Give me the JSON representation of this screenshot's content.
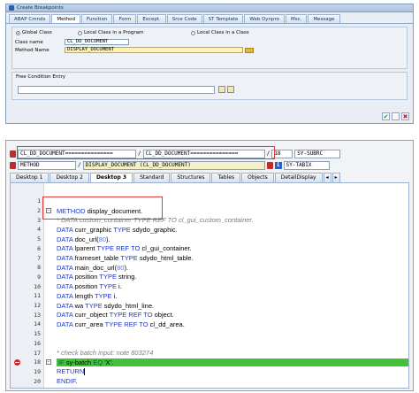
{
  "dialog": {
    "title": "Create Breakpoints",
    "tabs": [
      "ABAP Cmnds",
      "Method",
      "Function",
      "Form",
      "Except.",
      "Srce Code",
      "ST Template",
      "Web Dynpro",
      "Msc.",
      "Message"
    ],
    "active_tab": 1,
    "radios": [
      "Global Class",
      "Local Class in a Program",
      "Local Class in a Class"
    ],
    "selected_radio": 0,
    "class_label": "Class name",
    "class_value": "CL_DD_DOCUMENT",
    "method_label": "Method Name",
    "method_value": "DISPLAY_DOCUMENT",
    "free_entry_label": "Free Condition Entry",
    "ok_glyph": "✔",
    "cancel_glyph": "✖"
  },
  "debugger": {
    "var1_left": "CL_DD_DOCUMENT===============",
    "sep": "/",
    "var1_right": "CL_DD_DOCUMENT===============",
    "var1_num": "18",
    "var1_sys": "SY-SUBRC",
    "var2_left": "METHOD",
    "var2_right": "DISPLAY_DOCUMENT (CL_DD_DOCUMENT)",
    "var2_info": "i",
    "var2_sys": "SY-TABIX",
    "tabs": [
      "Desktop 1",
      "Desktop 2",
      "Desktop 3",
      "Standard",
      "Structures",
      "Tables",
      "Objects",
      "DetailDisplay"
    ],
    "active_tab": 2,
    "nav_prev": "◂",
    "nav_next": "▸",
    "fold_minus": "−",
    "fold_plus": "+"
  },
  "code_lines": [
    {
      "n": "1",
      "parts": []
    },
    {
      "n": "2",
      "fold": "−",
      "parts": [
        {
          "t": "METHOD",
          "c": "kw"
        },
        {
          "t": " display_document.",
          "c": "ident"
        }
      ]
    },
    {
      "n": "3",
      "parts": [
        {
          "t": "* DATA custom_container TYPE REF TO cl_gui_custom_container.",
          "c": "cm"
        }
      ]
    },
    {
      "n": "4",
      "parts": [
        {
          "t": "DATA",
          "c": "kw"
        },
        {
          "t": " curr_graphic ",
          "c": "ident"
        },
        {
          "t": "TYPE",
          "c": "kw"
        },
        {
          "t": " sdydo_graphic.",
          "c": "ident"
        }
      ]
    },
    {
      "n": "5",
      "parts": [
        {
          "t": "DATA",
          "c": "kw"
        },
        {
          "t": " doc_url(",
          "c": "ident"
        },
        {
          "t": "80",
          "c": "num"
        },
        {
          "t": ").",
          "c": "ident"
        }
      ]
    },
    {
      "n": "6",
      "parts": [
        {
          "t": "DATA",
          "c": "kw"
        },
        {
          "t": " lparent ",
          "c": "ident"
        },
        {
          "t": "TYPE REF TO",
          "c": "kw"
        },
        {
          "t": " cl_gui_container.",
          "c": "ident"
        }
      ]
    },
    {
      "n": "7",
      "parts": [
        {
          "t": "DATA",
          "c": "kw"
        },
        {
          "t": " frameset_table ",
          "c": "ident"
        },
        {
          "t": "TYPE",
          "c": "kw"
        },
        {
          "t": " sdydo_html_table.",
          "c": "ident"
        }
      ]
    },
    {
      "n": "8",
      "parts": [
        {
          "t": "DATA",
          "c": "kw"
        },
        {
          "t": " main_doc_url(",
          "c": "ident"
        },
        {
          "t": "80",
          "c": "num"
        },
        {
          "t": ").",
          "c": "ident"
        }
      ]
    },
    {
      "n": "9",
      "parts": [
        {
          "t": "DATA",
          "c": "kw"
        },
        {
          "t": " position ",
          "c": "ident"
        },
        {
          "t": "TYPE",
          "c": "kw"
        },
        {
          "t": " string.",
          "c": "ident"
        }
      ]
    },
    {
      "n": "10",
      "parts": [
        {
          "t": "DATA",
          "c": "kw"
        },
        {
          "t": " position ",
          "c": "ident"
        },
        {
          "t": "TYPE",
          "c": "kw"
        },
        {
          "t": " i.",
          "c": "ident"
        }
      ]
    },
    {
      "n": "11",
      "parts": [
        {
          "t": "DATA",
          "c": "kw"
        },
        {
          "t": " length ",
          "c": "ident"
        },
        {
          "t": "TYPE",
          "c": "kw"
        },
        {
          "t": " i.",
          "c": "ident"
        }
      ]
    },
    {
      "n": "12",
      "parts": [
        {
          "t": "DATA",
          "c": "kw"
        },
        {
          "t": " wa ",
          "c": "ident"
        },
        {
          "t": "TYPE",
          "c": "kw"
        },
        {
          "t": " sdydo_html_line.",
          "c": "ident"
        }
      ]
    },
    {
      "n": "13",
      "parts": [
        {
          "t": "DATA",
          "c": "kw"
        },
        {
          "t": " curr_object ",
          "c": "ident"
        },
        {
          "t": "TYPE REF TO",
          "c": "kw"
        },
        {
          "t": " object.",
          "c": "ident"
        }
      ]
    },
    {
      "n": "14",
      "parts": [
        {
          "t": "DATA",
          "c": "kw"
        },
        {
          "t": " curr_area ",
          "c": "ident"
        },
        {
          "t": "TYPE REF TO",
          "c": "kw"
        },
        {
          "t": " cl_dd_area.",
          "c": "ident"
        }
      ]
    },
    {
      "n": "15",
      "parts": []
    },
    {
      "n": "16",
      "parts": []
    },
    {
      "n": "17",
      "parts": [
        {
          "t": "* check batch input:",
          "c": "cm"
        },
        {
          "t": "                    note 803274",
          "c": "cm"
        }
      ]
    },
    {
      "n": "18",
      "bp": true,
      "current": true,
      "fold": "−",
      "parts": [
        {
          "t": "IF",
          "c": "kw"
        },
        {
          "t": " sy-batch ",
          "c": "ident"
        },
        {
          "t": "EQ",
          "c": "kw"
        },
        {
          "t": " 'X'.",
          "c": "ident"
        }
      ]
    },
    {
      "n": "19",
      "caret": true,
      "parts": [
        {
          "t": "  RETURN",
          "c": "kw"
        }
      ]
    },
    {
      "n": "20",
      "parts": [
        {
          "t": "ENDIF",
          "c": "kw"
        },
        {
          "t": ".",
          "c": "ident"
        }
      ]
    }
  ]
}
